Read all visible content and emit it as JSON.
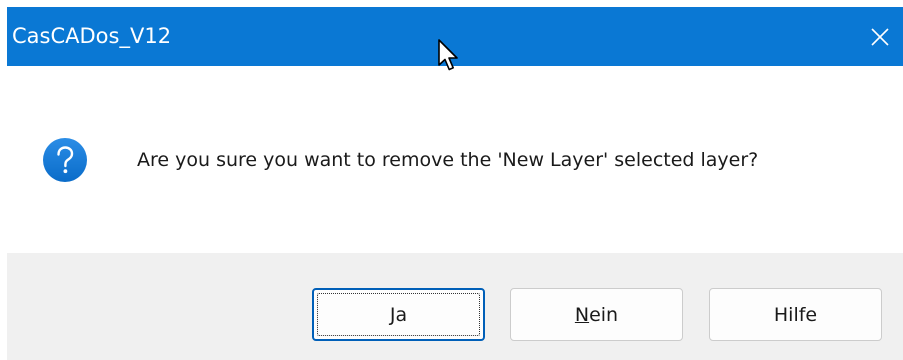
{
  "window": {
    "title": "CasCADos_V12",
    "accent_color": "#0a78d4",
    "close_icon": "close-icon"
  },
  "message": {
    "icon": "question-icon",
    "text": "Are you sure you want to remove the 'New Layer' selected layer?"
  },
  "buttons": {
    "yes": {
      "mnemonic": "J",
      "rest": "a"
    },
    "no": {
      "mnemonic": "N",
      "rest": "ein"
    },
    "help": {
      "label": "Hilfe"
    }
  }
}
